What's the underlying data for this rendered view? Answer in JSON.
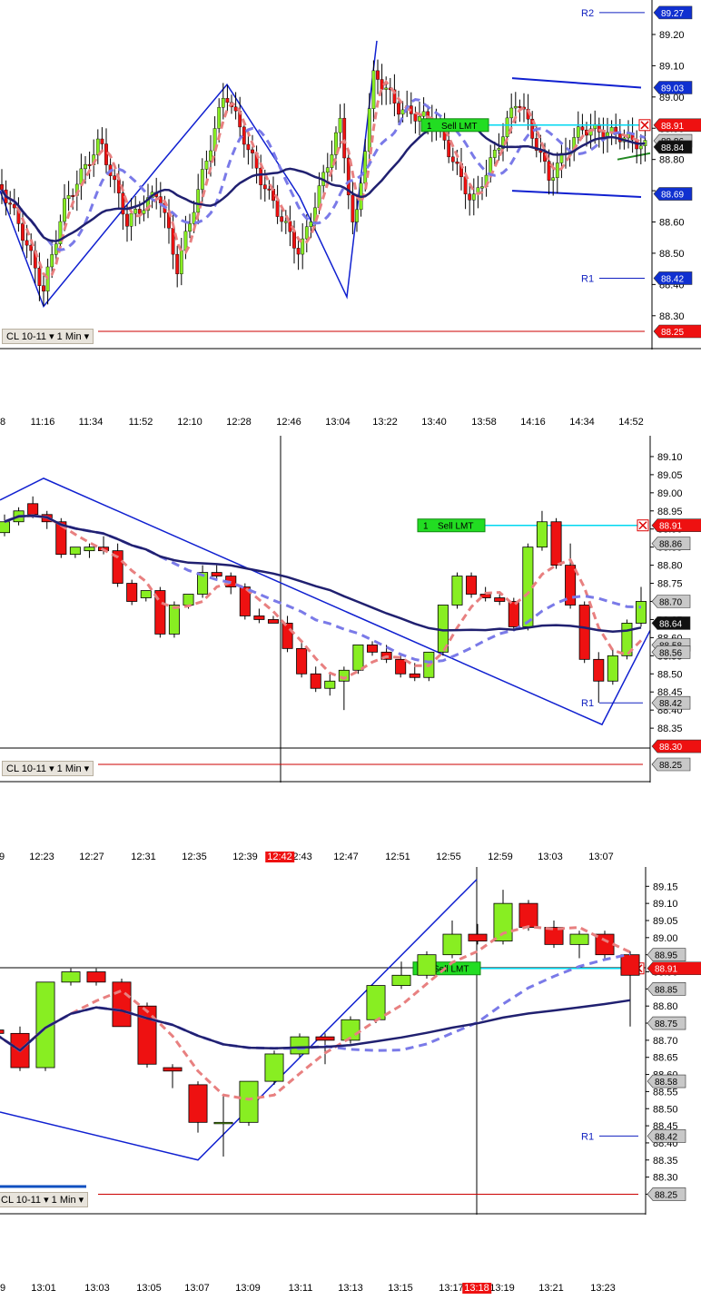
{
  "instrument_label": "CL 10-11",
  "interval_label": "1 Min",
  "order": {
    "qty": "1",
    "label": "Sell LMT"
  },
  "chart_data": [
    {
      "type": "candlestick",
      "ylim": [
        88.25,
        89.29
      ],
      "y_ticks": [
        "89.20",
        "89.10",
        "89.00",
        "88.90",
        "88.80",
        "88.70",
        "88.60",
        "88.50",
        "88.40",
        "88.30"
      ],
      "x_ticks": [
        "8",
        "11:16",
        "11:34",
        "11:52",
        "12:10",
        "12:28",
        "12:46",
        "13:04",
        "13:22",
        "13:40",
        "13:58",
        "14:16",
        "14:34",
        "14:52"
      ],
      "price_tags": [
        {
          "value": "89.27",
          "kind": "blue"
        },
        {
          "value": "89.03",
          "kind": "blue"
        },
        {
          "value": "88.91",
          "kind": "order"
        },
        {
          "value": "88.86",
          "kind": "grey"
        },
        {
          "value": "88.84",
          "kind": "dark"
        },
        {
          "value": "88.69",
          "kind": "blue"
        },
        {
          "value": "88.42",
          "kind": "blue"
        },
        {
          "value": "88.25",
          "kind": "red"
        }
      ],
      "levels": [
        {
          "name": "R2",
          "value": 89.27
        },
        {
          "name": "R1",
          "value": 88.42
        },
        {
          "name": "",
          "value": 88.25
        }
      ],
      "order_price": 88.91
    },
    {
      "type": "candlestick",
      "ylim": [
        88.25,
        89.15
      ],
      "y_ticks": [
        "89.10",
        "89.05",
        "89.00",
        "88.95",
        "88.90",
        "88.85",
        "88.80",
        "88.75",
        "88.70",
        "88.65",
        "88.60",
        "88.55",
        "88.50",
        "88.45",
        "88.40",
        "88.35"
      ],
      "price_tags": [
        {
          "value": "88.91",
          "kind": "order"
        },
        {
          "value": "88.86",
          "kind": "grey"
        },
        {
          "value": "88.70",
          "kind": "grey"
        },
        {
          "value": "88.64",
          "kind": "dark"
        },
        {
          "value": "88.58",
          "kind": "grey"
        },
        {
          "value": "88.56",
          "kind": "grey"
        },
        {
          "value": "88.42",
          "kind": "grey"
        },
        {
          "value": "88.30",
          "kind": "red"
        },
        {
          "value": "88.25",
          "kind": "grey"
        }
      ],
      "levels": [
        {
          "name": "R1",
          "value": 88.42
        },
        {
          "name": "",
          "value": 88.25
        }
      ],
      "order_price": 88.91,
      "candles": [
        [
          88.89,
          88.94,
          88.88,
          88.92
        ],
        [
          88.92,
          88.96,
          88.91,
          88.95
        ],
        [
          88.97,
          88.99,
          88.93,
          88.94
        ],
        [
          88.94,
          88.95,
          88.9,
          88.92
        ],
        [
          88.92,
          88.93,
          88.82,
          88.83
        ],
        [
          88.83,
          88.85,
          88.82,
          88.85
        ],
        [
          88.84,
          88.86,
          88.82,
          88.85
        ],
        [
          88.85,
          88.88,
          88.83,
          88.84
        ],
        [
          88.84,
          88.86,
          88.74,
          88.75
        ],
        [
          88.75,
          88.76,
          88.69,
          88.7
        ],
        [
          88.71,
          88.73,
          88.7,
          88.73
        ],
        [
          88.73,
          88.74,
          88.6,
          88.61
        ],
        [
          88.61,
          88.7,
          88.6,
          88.69
        ],
        [
          88.69,
          88.72,
          88.68,
          88.72
        ],
        [
          88.72,
          88.8,
          88.71,
          88.78
        ],
        [
          88.78,
          88.8,
          88.76,
          88.77
        ],
        [
          88.77,
          88.78,
          88.72,
          88.74
        ],
        [
          88.74,
          88.75,
          88.65,
          88.66
        ],
        [
          88.66,
          88.68,
          88.64,
          88.65
        ],
        [
          88.65,
          88.66,
          88.64,
          88.64
        ],
        [
          88.64,
          88.66,
          88.56,
          88.57
        ],
        [
          88.57,
          88.59,
          88.49,
          88.5
        ],
        [
          88.5,
          88.52,
          88.45,
          88.46
        ],
        [
          88.46,
          88.5,
          88.44,
          88.48
        ],
        [
          88.48,
          88.52,
          88.4,
          88.51
        ],
        [
          88.51,
          88.58,
          88.5,
          88.58
        ],
        [
          88.58,
          88.59,
          88.55,
          88.56
        ],
        [
          88.56,
          88.58,
          88.53,
          88.54
        ],
        [
          88.54,
          88.55,
          88.49,
          88.5
        ],
        [
          88.5,
          88.53,
          88.48,
          88.49
        ],
        [
          88.49,
          88.56,
          88.48,
          88.56
        ],
        [
          88.56,
          88.69,
          88.55,
          88.69
        ],
        [
          88.69,
          88.78,
          88.68,
          88.77
        ],
        [
          88.77,
          88.78,
          88.71,
          88.72
        ],
        [
          88.72,
          88.74,
          88.7,
          88.71
        ],
        [
          88.71,
          88.72,
          88.69,
          88.7
        ],
        [
          88.7,
          88.71,
          88.62,
          88.63
        ],
        [
          88.63,
          88.86,
          88.62,
          88.85
        ],
        [
          88.85,
          88.95,
          88.84,
          88.92
        ],
        [
          88.92,
          88.93,
          88.79,
          88.8
        ],
        [
          88.8,
          88.86,
          88.68,
          88.69
        ],
        [
          88.69,
          88.7,
          88.53,
          88.54
        ],
        [
          88.54,
          88.56,
          88.42,
          88.48
        ],
        [
          88.48,
          88.57,
          88.47,
          88.55
        ],
        [
          88.55,
          88.65,
          88.54,
          88.64
        ],
        [
          88.64,
          88.74,
          88.63,
          88.7
        ]
      ]
    },
    {
      "type": "candlestick",
      "ylim": [
        88.23,
        89.18
      ],
      "y_ticks": [
        "89.15",
        "89.10",
        "89.05",
        "89.00",
        "88.95",
        "88.90",
        "88.85",
        "88.80",
        "88.75",
        "88.70",
        "88.65",
        "88.60",
        "88.55",
        "88.50",
        "88.45",
        "88.40",
        "88.35",
        "88.30",
        "88.25"
      ],
      "x_ticks": [
        "9",
        "13:01",
        "13:03",
        "13:05",
        "13:07",
        "13:09",
        "13:11",
        "13:13",
        "13:15",
        "13:17",
        "13:19",
        "13:21",
        "13:23"
      ],
      "x_ticks_upper": [
        "9",
        "12:23",
        "12:27",
        "12:31",
        "12:35",
        "12:39",
        "12:43",
        "12:47",
        "12:51",
        "12:55",
        "12:59",
        "13:03",
        "13:07"
      ],
      "cursor_time_upper": "12:42",
      "cursor_time": "13:18",
      "price_tags": [
        {
          "value": "88.95",
          "kind": "grey"
        },
        {
          "value": "88.91",
          "kind": "order"
        },
        {
          "value": "88.85",
          "kind": "grey"
        },
        {
          "value": "88.75",
          "kind": "grey"
        },
        {
          "value": "88.58",
          "kind": "grey"
        },
        {
          "value": "88.42",
          "kind": "grey"
        },
        {
          "value": "88.25",
          "kind": "grey"
        }
      ],
      "levels": [
        {
          "name": "R1",
          "value": 88.42
        },
        {
          "name": "",
          "value": 88.25
        }
      ],
      "order_price": 88.91,
      "candles": [
        [
          88.73,
          88.74,
          88.71,
          88.72
        ],
        [
          88.72,
          88.74,
          88.61,
          88.62
        ],
        [
          88.62,
          88.87,
          88.61,
          88.87
        ],
        [
          88.87,
          88.91,
          88.86,
          88.9
        ],
        [
          88.9,
          88.91,
          88.86,
          88.87
        ],
        [
          88.87,
          88.88,
          88.74,
          88.74
        ],
        [
          88.8,
          88.81,
          88.62,
          88.63
        ],
        [
          88.62,
          88.63,
          88.56,
          88.61
        ],
        [
          88.57,
          88.58,
          88.43,
          88.46
        ],
        [
          88.46,
          88.54,
          88.36,
          88.46
        ],
        [
          88.46,
          88.58,
          88.45,
          88.58
        ],
        [
          88.58,
          88.67,
          88.57,
          88.66
        ],
        [
          88.66,
          88.72,
          88.65,
          88.71
        ],
        [
          88.71,
          88.72,
          88.63,
          88.7
        ],
        [
          88.7,
          88.77,
          88.69,
          88.76
        ],
        [
          88.76,
          88.86,
          88.75,
          88.86
        ],
        [
          88.86,
          88.93,
          88.85,
          88.89
        ],
        [
          88.89,
          88.96,
          88.88,
          88.95
        ],
        [
          88.95,
          89.05,
          88.94,
          89.01
        ],
        [
          89.01,
          89.04,
          88.98,
          88.99
        ],
        [
          88.99,
          89.14,
          88.98,
          89.1
        ],
        [
          89.1,
          89.11,
          89.02,
          89.03
        ],
        [
          89.03,
          89.05,
          88.97,
          88.98
        ],
        [
          88.98,
          89.02,
          88.94,
          89.01
        ],
        [
          89.01,
          89.02,
          88.94,
          88.95
        ],
        [
          88.95,
          88.96,
          88.74,
          88.89
        ]
      ]
    }
  ]
}
